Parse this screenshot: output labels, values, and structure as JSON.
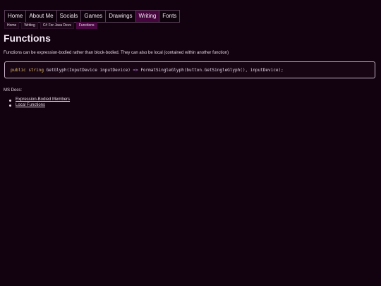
{
  "nav": {
    "items": [
      {
        "label": "Home"
      },
      {
        "label": "About Me"
      },
      {
        "label": "Socials"
      },
      {
        "label": "Games"
      },
      {
        "label": "Drawings"
      },
      {
        "label": "Writing"
      },
      {
        "label": "Fonts"
      }
    ],
    "active": "Writing"
  },
  "breadcrumb": {
    "items": [
      {
        "label": "Home"
      },
      {
        "label": "Writing"
      },
      {
        "label": "C# For Java Devs"
      },
      {
        "label": "Functions"
      }
    ]
  },
  "page": {
    "title": "Functions",
    "intro": "Functions can be expression-bodied rather than block-bodied. They can also be local (contained within another function)"
  },
  "code": {
    "tokens": [
      {
        "text": "public",
        "kind": "kw"
      },
      {
        "text": " ",
        "kind": "id"
      },
      {
        "text": "string",
        "kind": "kw"
      },
      {
        "text": " GetGlyph",
        "kind": "id"
      },
      {
        "text": "(",
        "kind": "punc"
      },
      {
        "text": "InputDevice inputDevice",
        "kind": "id"
      },
      {
        "text": ")",
        "kind": "punc"
      },
      {
        "text": " => ",
        "kind": "op"
      },
      {
        "text": "FormatSingleGlyph",
        "kind": "id"
      },
      {
        "text": "(",
        "kind": "punc"
      },
      {
        "text": "button",
        "kind": "id"
      },
      {
        "text": ".",
        "kind": "punc"
      },
      {
        "text": "GetSingleGlyph",
        "kind": "id"
      },
      {
        "text": "(), ",
        "kind": "punc"
      },
      {
        "text": "inputDevice",
        "kind": "id"
      },
      {
        "text": ");",
        "kind": "punc"
      }
    ]
  },
  "docs": {
    "label": "MS Docs:",
    "links": [
      {
        "label": "Expression-Bodied Members"
      },
      {
        "label": "Local Functions"
      }
    ]
  }
}
